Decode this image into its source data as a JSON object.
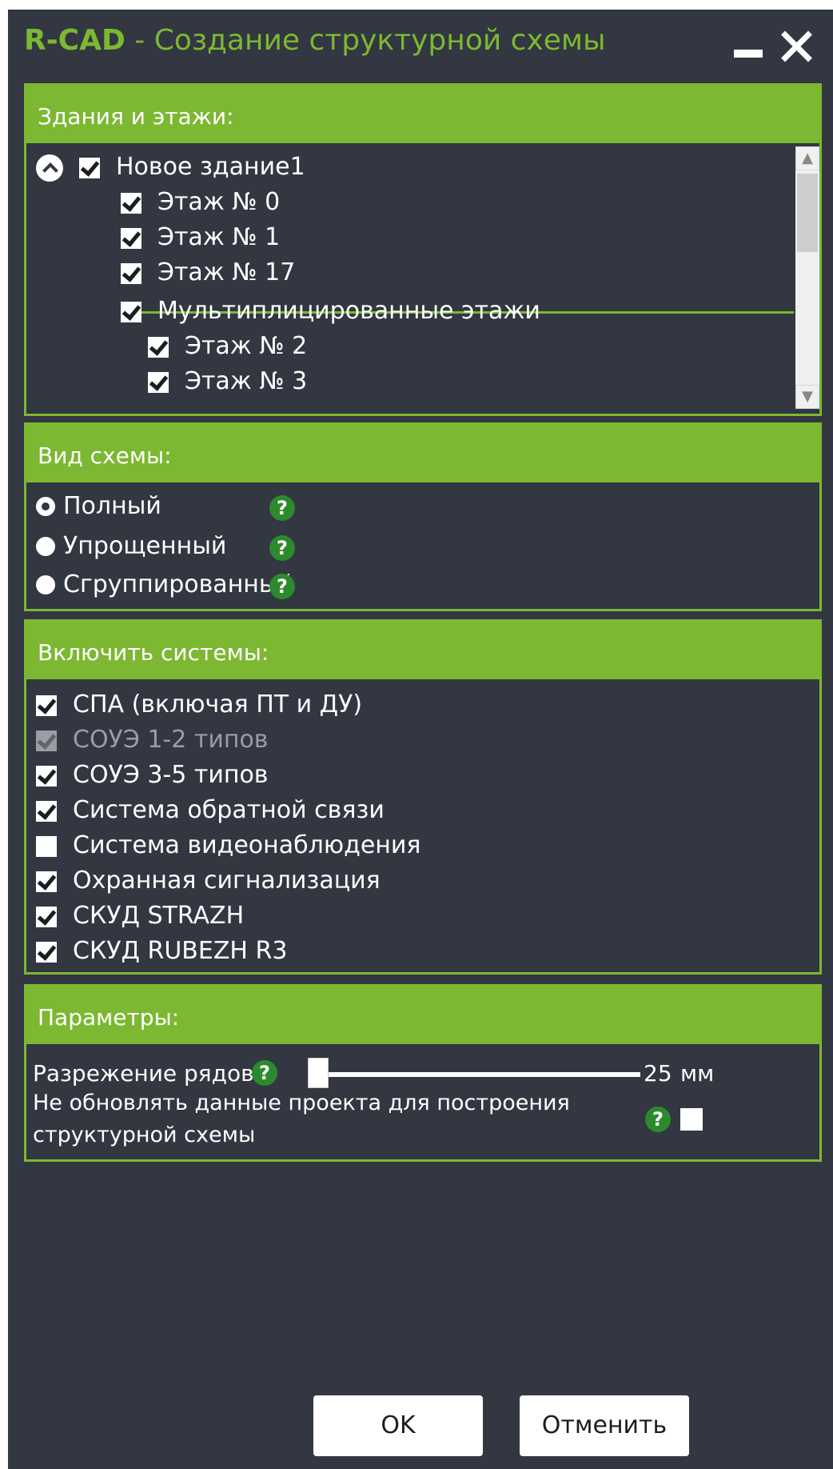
{
  "window": {
    "brand": "R-CAD",
    "title_rest": " - Создание структурной схемы",
    "accent_color": "#7cb832",
    "background_color": "#323741"
  },
  "buildings": {
    "header": "Здания и этажи:",
    "building": {
      "label": "Новое здание1",
      "checked": true,
      "expanded": true
    },
    "floors": [
      {
        "label": "Этаж № 0",
        "checked": true
      },
      {
        "label": "Этаж № 1",
        "checked": true
      },
      {
        "label": "Этаж № 17",
        "checked": true
      },
      {
        "label": "Мультиплицированные этажи",
        "checked": true
      },
      {
        "label": "Этаж № 2",
        "checked": true
      },
      {
        "label": "Этаж № 3",
        "checked": true
      }
    ]
  },
  "schema_view": {
    "header": "Вид схемы:",
    "options": [
      {
        "label": "Полный",
        "selected": true
      },
      {
        "label": "Упрощенный",
        "selected": false
      },
      {
        "label": "Сгруппированный",
        "selected": false
      }
    ],
    "help_glyph": "?"
  },
  "systems": {
    "header": "Включить системы:",
    "items": [
      {
        "label": "СПА (включая ПТ и ДУ)",
        "checked": true,
        "disabled": false
      },
      {
        "label": "СОУЭ 1-2 типов",
        "checked": true,
        "disabled": true
      },
      {
        "label": "СОУЭ 3-5 типов",
        "checked": true,
        "disabled": false
      },
      {
        "label": "Система обратной связи",
        "checked": true,
        "disabled": false
      },
      {
        "label": "Система видеонаблюдения",
        "checked": false,
        "disabled": false
      },
      {
        "label": "Охранная сигнализация",
        "checked": true,
        "disabled": false
      },
      {
        "label": "СКУД STRAZH",
        "checked": true,
        "disabled": false
      },
      {
        "label": "СКУД RUBEZH R3",
        "checked": true,
        "disabled": false
      }
    ]
  },
  "params": {
    "header": "Параметры:",
    "row_spacing_label": "Разрежение рядов",
    "row_spacing_value": "25",
    "row_spacing_unit": "мм",
    "no_update_line1": "Не обновлять данные проекта для построения",
    "no_update_line2": "структурной схемы",
    "no_update_checked": false
  },
  "buttons": {
    "ok": "OK",
    "cancel": "Отменить"
  },
  "icons": {
    "minimize": "minimize-icon",
    "close": "close-icon",
    "collapse": "chevron-up-icon",
    "help": "help-icon",
    "scroll_up": "▲",
    "scroll_down": "▼"
  }
}
